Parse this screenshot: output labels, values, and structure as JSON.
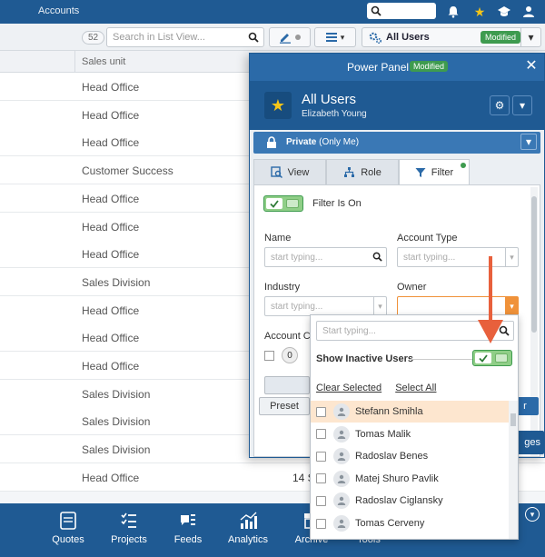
{
  "topbar": {
    "breadcrumb": "Accounts"
  },
  "toolbar": {
    "record_count": "52",
    "search_placeholder": "Search in List View...",
    "view_name": "All Users",
    "view_status": "Modified"
  },
  "list": {
    "column_header": "Sales unit",
    "rows": [
      "Head Office",
      "Head Office",
      "Head Office",
      "Customer Success",
      "Head Office",
      "Head Office",
      "Head Office",
      "Sales Division",
      "Head Office",
      "Head Office",
      "Head Office",
      "Sales Division",
      "Sales Division",
      "Sales Division",
      "Head Office"
    ],
    "row_value": "14 S"
  },
  "bottom_nav": {
    "items": [
      "Quotes",
      "Projects",
      "Feeds",
      "Analytics",
      "Archive",
      "Tools"
    ]
  },
  "panel": {
    "title": "Power Panel",
    "status": "Modified",
    "view_title": "All Users",
    "view_owner": "Elizabeth Young",
    "privacy": "Private",
    "privacy_note": "(Only Me)",
    "tabs": [
      "View",
      "Role",
      "Filter"
    ],
    "filter_label": "Filter Is On",
    "fields": {
      "name_label": "Name",
      "name_placeholder": "start typing...",
      "type_label": "Account Type",
      "type_placeholder": "start typing...",
      "industry_label": "Industry",
      "industry_placeholder": "start typing...",
      "owner_label": "Owner",
      "account_label_partial": "Account Cl",
      "zero": "0"
    },
    "preset_button": "Preset",
    "apply_partial": "r",
    "changes_partial": "ges"
  },
  "owner_dropdown": {
    "search_placeholder": "Start typing...",
    "inactive_label": "Show Inactive Users",
    "clear_selected": "Clear Selected",
    "select_all": "Select All",
    "users": [
      "Stefann Smihla",
      "Tomas Malik",
      "Radoslav Benes",
      "Matej Shuro Pavlik",
      "Radoslav Ciglansky",
      "Tomas Cerveny"
    ]
  },
  "colors": {
    "primary": "#1f5a93",
    "success": "#3e9b4f",
    "highlight": "#fde6cf",
    "arrow": "#e8603c"
  }
}
